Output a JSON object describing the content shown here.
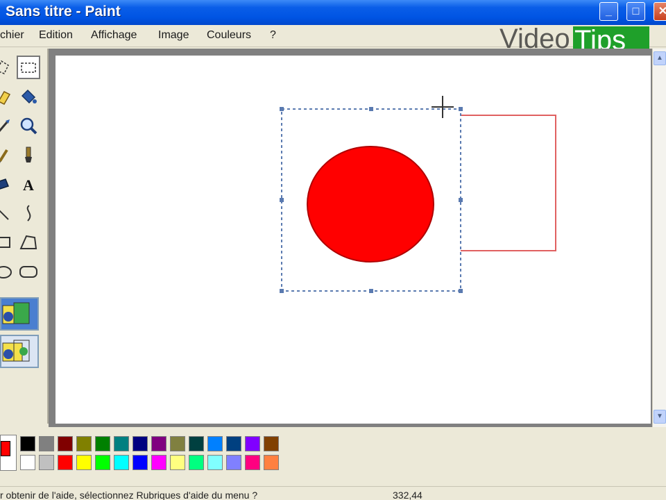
{
  "window": {
    "title": "Sans titre - Paint",
    "controls": {
      "minimize_glyph": "_",
      "maximize_glyph": "□",
      "close_glyph": "✕"
    }
  },
  "menu": {
    "items": [
      {
        "label": "chier"
      },
      {
        "label": "Edition"
      },
      {
        "label": "Affichage"
      },
      {
        "label": "Image"
      },
      {
        "label": "Couleurs"
      },
      {
        "label": "?"
      }
    ]
  },
  "watermark": {
    "video": "Video",
    "tips": "Tips"
  },
  "tools": [
    {
      "name": "free-select-tool-icon"
    },
    {
      "name": "rect-select-tool-icon",
      "selected": true
    },
    {
      "name": "eraser-tool-icon"
    },
    {
      "name": "fill-tool-icon"
    },
    {
      "name": "color-picker-tool-icon"
    },
    {
      "name": "magnifier-tool-icon"
    },
    {
      "name": "pencil-tool-icon"
    },
    {
      "name": "brush-tool-icon"
    },
    {
      "name": "airbrush-tool-icon"
    },
    {
      "name": "text-tool-icon",
      "glyph": "A"
    },
    {
      "name": "line-tool-icon"
    },
    {
      "name": "curve-tool-icon"
    },
    {
      "name": "rectangle-tool-icon"
    },
    {
      "name": "polygon-tool-icon"
    },
    {
      "name": "ellipse-tool-icon"
    },
    {
      "name": "rounded-rect-tool-icon"
    }
  ],
  "tool_options": [
    {
      "name": "opaque-selection-option",
      "active": true
    },
    {
      "name": "transparent-selection-option",
      "active": false
    }
  ],
  "palette": {
    "current_foreground": "#ff0000",
    "current_background": "#ffffff",
    "row1": [
      "#000000",
      "#808080",
      "#800000",
      "#808000",
      "#008000",
      "#008080",
      "#000080",
      "#800080",
      "#808040",
      "#004040",
      "#0080ff",
      "#004080",
      "#8000ff",
      "#804000"
    ],
    "row2": [
      "#ffffff",
      "#c0c0c0",
      "#ff0000",
      "#ffff00",
      "#00ff00",
      "#00ffff",
      "#0000ff",
      "#ff00ff",
      "#ffff80",
      "#00ff80",
      "#80ffff",
      "#8080ff",
      "#ff0080",
      "#ff8040"
    ]
  },
  "status": {
    "help_text": "r obtenir de l'aide, sélectionnez Rubriques d'aide du menu ?",
    "coords": "332,44"
  },
  "drawing": {
    "circle_fill": "#ff0000",
    "rectangle_stroke": "#e06060",
    "selection_color": "#5a7ab0"
  }
}
